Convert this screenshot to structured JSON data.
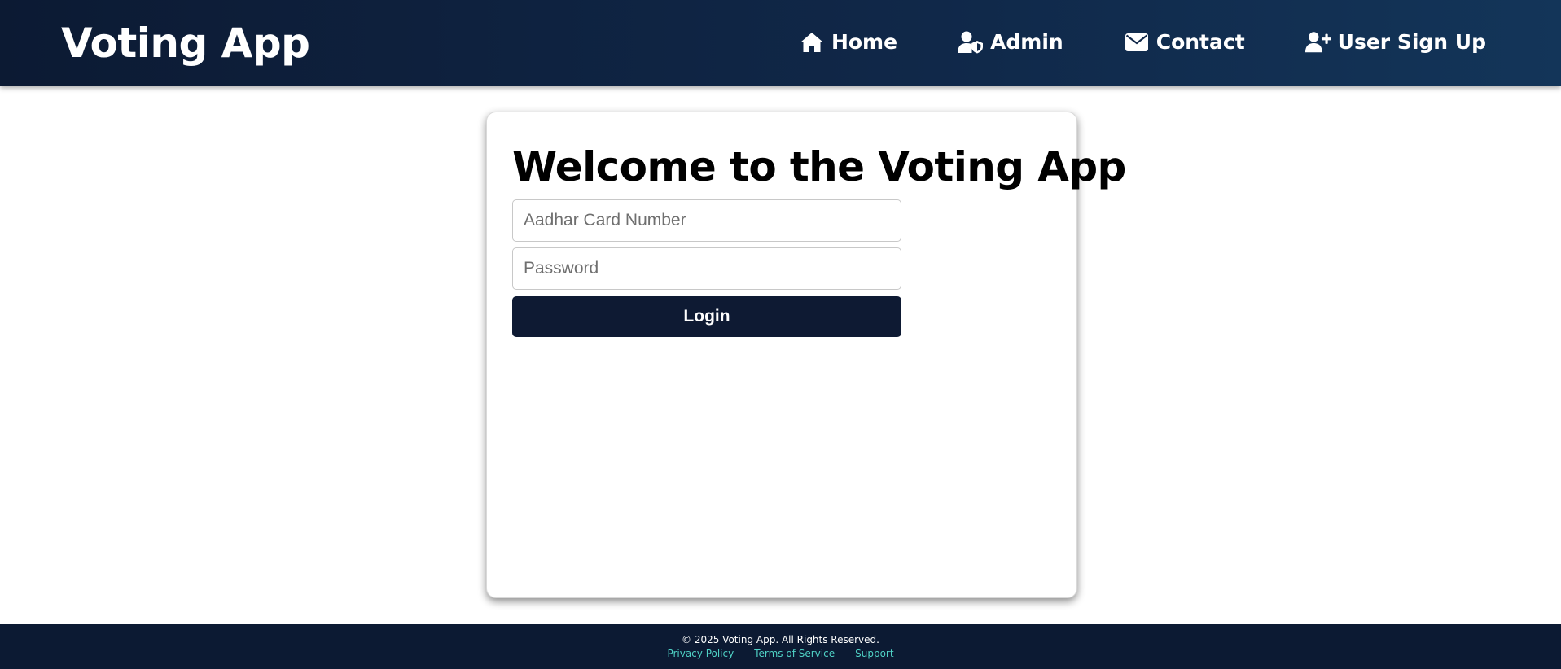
{
  "header": {
    "brand": "Voting App",
    "nav": [
      {
        "label": "Home",
        "icon": "home-icon"
      },
      {
        "label": "Admin",
        "icon": "user-shield-icon"
      },
      {
        "label": "Contact",
        "icon": "envelope-icon"
      },
      {
        "label": "User Sign Up",
        "icon": "user-plus-icon"
      }
    ]
  },
  "login": {
    "title": "Welcome to the Voting App",
    "aadhar_placeholder": "Aadhar Card Number",
    "aadhar_value": "",
    "password_placeholder": "Password",
    "password_value": "",
    "button_label": "Login"
  },
  "footer": {
    "copyright": "© 2025 Voting App. All Rights Reserved.",
    "links": [
      "Privacy Policy",
      "Terms of Service",
      "Support"
    ]
  },
  "colors": {
    "navbar": "#0c1a33",
    "button": "#0e1a33",
    "footer_link": "#4fd1c5"
  }
}
